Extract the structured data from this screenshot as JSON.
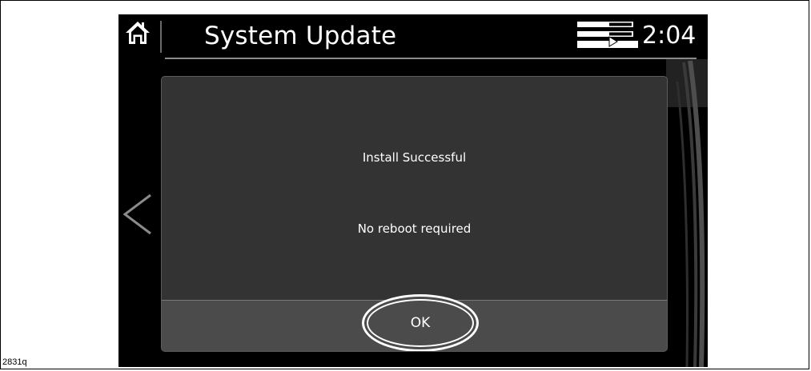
{
  "figure": {
    "id": "2831q"
  },
  "header": {
    "home_icon": "home-icon",
    "title": "System Update",
    "status_icon": "media-status-icon",
    "time": "2:04"
  },
  "nav": {
    "back_icon": "chevron-left-icon"
  },
  "dialog": {
    "message": "Install Successful",
    "detail": "No reboot required",
    "ok_label": "OK"
  },
  "colors": {
    "screen_bg": "#000000",
    "dialog_bg": "#333333",
    "footer_bg": "#4b4b4b",
    "text": "#ffffff"
  }
}
